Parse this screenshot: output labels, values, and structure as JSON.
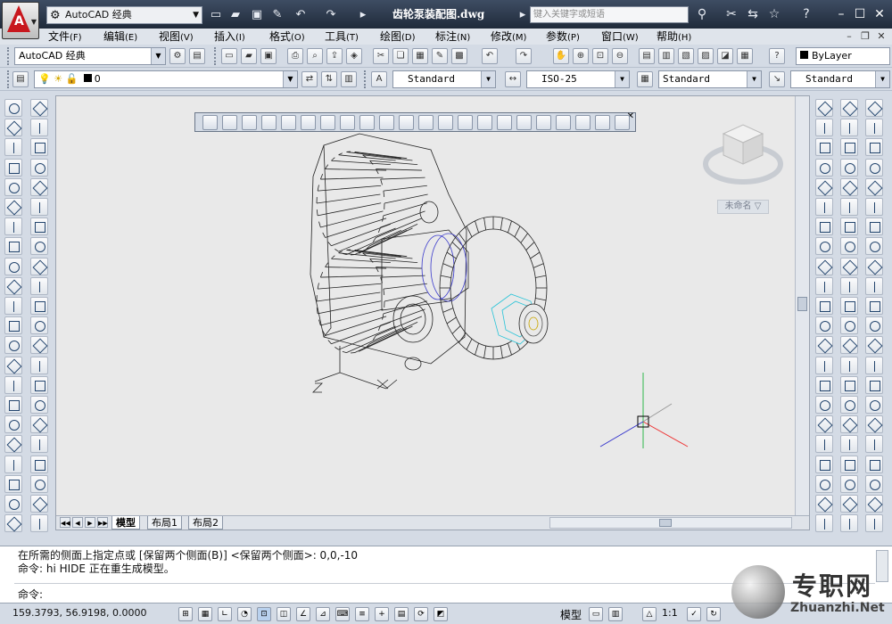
{
  "title_bar": {
    "workspace": "AutoCAD 经典",
    "document_title": "齿轮泵装配图.dwg",
    "search_placeholder": "键入关键字或短语"
  },
  "menu": [
    {
      "label": "文件",
      "accel": "(F)"
    },
    {
      "label": "编辑",
      "accel": "(E)"
    },
    {
      "label": "视图",
      "accel": "(V)"
    },
    {
      "label": "插入",
      "accel": "(I)"
    },
    {
      "label": "格式",
      "accel": "(O)"
    },
    {
      "label": "工具",
      "accel": "(T)"
    },
    {
      "label": "绘图",
      "accel": "(D)"
    },
    {
      "label": "标注",
      "accel": "(N)"
    },
    {
      "label": "修改",
      "accel": "(M)"
    },
    {
      "label": "参数",
      "accel": "(P)"
    },
    {
      "label": "窗口",
      "accel": "(W)"
    },
    {
      "label": "帮助",
      "accel": "(H)"
    }
  ],
  "toolbar": {
    "workspace_combo": "AutoCAD 经典",
    "color_combo": "ByLayer",
    "layer_combo": "0",
    "text_style": "Standard",
    "dim_style": "ISO-25",
    "table_style": "Standard",
    "mleader_style": "Standard"
  },
  "drawing": {
    "viewcube_label": "未命名 ▽"
  },
  "layout_tabs": [
    "模型",
    "布局1",
    "布局2"
  ],
  "command": {
    "history": [
      "在所需的侧面上指定点或 [保留两个侧面(B)] <保留两个侧面>: 0,0,-10",
      "命令: hi HIDE 正在重生成模型。"
    ],
    "prompt": "命令:"
  },
  "status": {
    "coordinates": "159.3793, 56.9198, 0.0000",
    "model_label": "模型",
    "scale": "1:1"
  },
  "watermark": {
    "cn": "专职网",
    "en": "Zhuanzhi.Net"
  }
}
